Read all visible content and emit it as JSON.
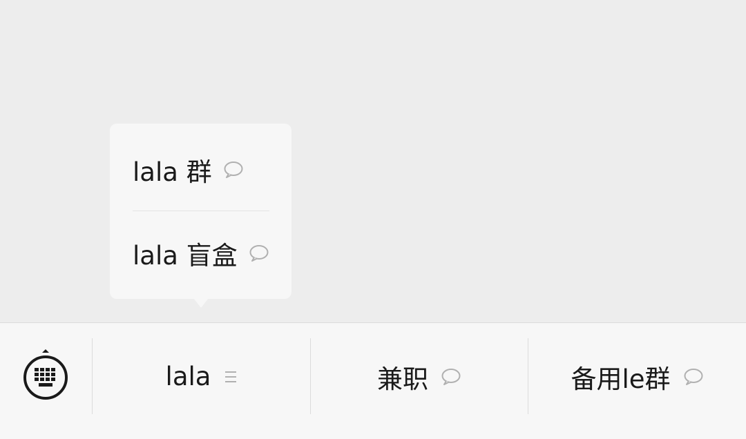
{
  "popup": {
    "items": [
      {
        "label": "lala 群",
        "icon": "chat-bubble-icon"
      },
      {
        "label": "lala 盲盒",
        "icon": "chat-bubble-icon"
      }
    ]
  },
  "menubar": {
    "keyboard_icon": "keyboard-toggle-icon",
    "items": [
      {
        "label": "lala",
        "icon": "submenu-list-icon"
      },
      {
        "label": "兼职",
        "icon": "chat-bubble-icon"
      },
      {
        "label": "备用le群",
        "icon": "chat-bubble-icon"
      }
    ]
  },
  "colors": {
    "background": "#ededed",
    "panel": "#f7f7f7",
    "text": "#1a1a1a",
    "icon_gray": "#b0b0b0",
    "divider": "#dcdcdc"
  }
}
